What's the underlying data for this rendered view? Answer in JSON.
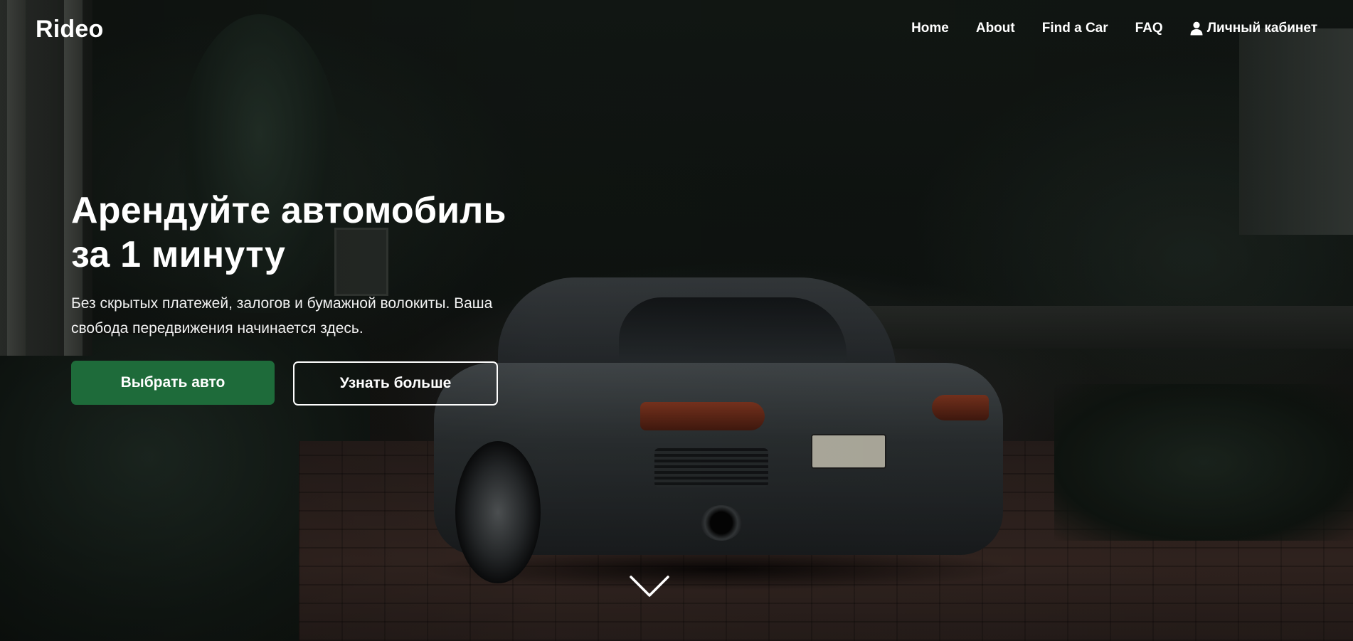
{
  "header": {
    "logo": "Rideo",
    "nav": {
      "home": "Home",
      "about": "About",
      "find_car": "Find a Car",
      "faq": "FAQ",
      "account": "Личный кабинет"
    }
  },
  "hero": {
    "title_line1": "Арендуйте автомобиль",
    "title_line2": "за 1 минуту",
    "description": "Без скрытых платежей, залогов и бумажной волокиты. Ваша свобода передвижения начинается здесь.",
    "primary_button": "Выбрать авто",
    "secondary_button": "Узнать больше"
  },
  "icons": {
    "account": "user-icon",
    "scroll": "chevron-down-icon"
  },
  "colors": {
    "accent": "#1e6b3a",
    "text": "#ffffff"
  }
}
